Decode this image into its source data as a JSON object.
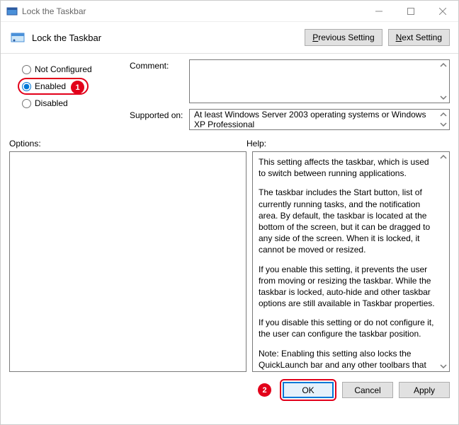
{
  "window": {
    "title": "Lock the Taskbar",
    "header_title": "Lock the Taskbar"
  },
  "nav": {
    "previous_label_pre": "P",
    "previous_label_rest": "revious Setting",
    "next_label_pre": "N",
    "next_label_rest": "ext Setting"
  },
  "radios": {
    "not_configured": "Not Configured",
    "enabled": "Enabled",
    "disabled": "Disabled",
    "selected": "enabled"
  },
  "callouts": {
    "badge1": "1",
    "badge2": "2"
  },
  "fields": {
    "comment_label": "Comment:",
    "comment_value": "",
    "supported_label": "Supported on:",
    "supported_value": "At least Windows Server 2003 operating systems or Windows XP Professional"
  },
  "lower": {
    "options_label": "Options:",
    "help_label": "Help:"
  },
  "help": {
    "p1": "This setting affects the taskbar, which is used to switch between running applications.",
    "p2": "The taskbar includes the Start button, list of currently running tasks, and the notification area. By default, the taskbar is located at the bottom of the screen, but it can be dragged to any side of the screen. When it is locked, it cannot be moved or resized.",
    "p3": "If you enable this setting, it prevents the user from moving or resizing the taskbar. While the taskbar is locked, auto-hide and other taskbar options are still available in Taskbar properties.",
    "p4": "If you disable this setting or do not configure it, the user can configure the taskbar position.",
    "p5": "Note: Enabling this setting also locks the QuickLaunch bar and any other toolbars that the user has on their taskbar. The toolbar's position is locked, and the user cannot show and hide various toolbars using the taskbar context menu."
  },
  "buttons": {
    "ok": "OK",
    "cancel": "Cancel",
    "apply": "Apply"
  }
}
